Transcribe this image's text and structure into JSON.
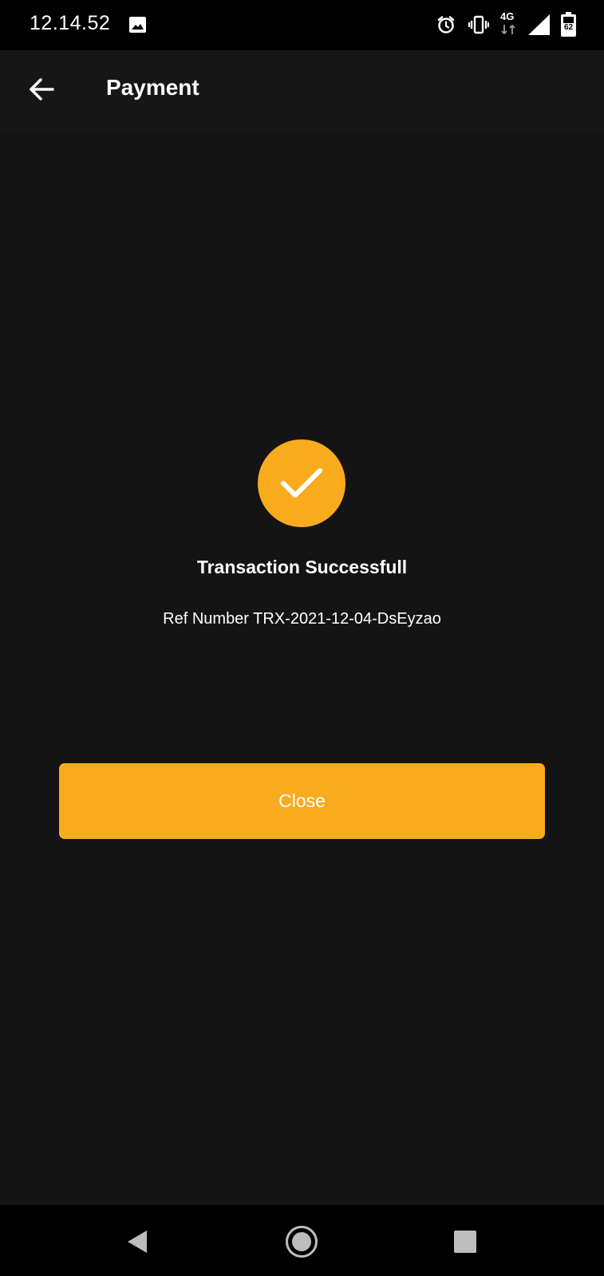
{
  "status_bar": {
    "time": "12.14.52",
    "network_label": "4G",
    "battery_level": "62",
    "icons": [
      "image-icon",
      "alarm-icon",
      "vibrate-icon",
      "network-4g-icon",
      "signal-icon",
      "battery-icon"
    ]
  },
  "app_bar": {
    "title": "Payment",
    "back_icon": "arrow-left-icon"
  },
  "result": {
    "icon": "check-icon",
    "title": "Transaction Successfull",
    "ref_line": "Ref Number TRX-2021-12-04-DsEyzao"
  },
  "actions": {
    "close_label": "Close"
  },
  "nav_bar": {
    "icons": [
      "back-triangle-icon",
      "home-circle-icon",
      "recents-square-icon"
    ]
  },
  "colors": {
    "background": "#141414",
    "accent": "#f9ab1e",
    "text": "#ffffff",
    "status_bar": "#000000"
  }
}
